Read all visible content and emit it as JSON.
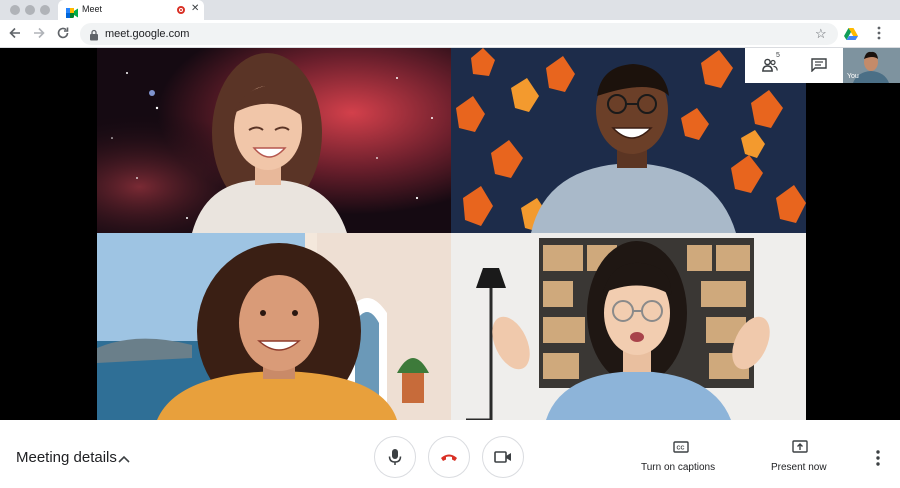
{
  "browser": {
    "tab": {
      "title": "Meet"
    },
    "address_bar": {
      "url": "meet.google.com"
    }
  },
  "meeting": {
    "participant_count": "5",
    "self_label": "You",
    "details_label": "Meeting details"
  },
  "controls": {
    "captions_label": "Turn on captions",
    "present_label": "Present now"
  },
  "icons": {
    "back": "arrow-left-icon",
    "forward": "arrow-right-icon",
    "reload": "reload-icon",
    "lock": "lock-icon",
    "bookmark": "star-icon",
    "extension": "drive-icon",
    "menu": "kebab-menu-icon",
    "people": "people-icon",
    "chat": "chat-icon",
    "mic": "microphone-icon",
    "hangup": "hang-up-icon",
    "camera": "camera-icon",
    "captions": "captions-icon",
    "present": "present-icon"
  },
  "colors": {
    "hangup_red": "#d93025",
    "recording_red": "#d93025",
    "stage_background": "#000000",
    "icon_gray": "#5f6368"
  }
}
